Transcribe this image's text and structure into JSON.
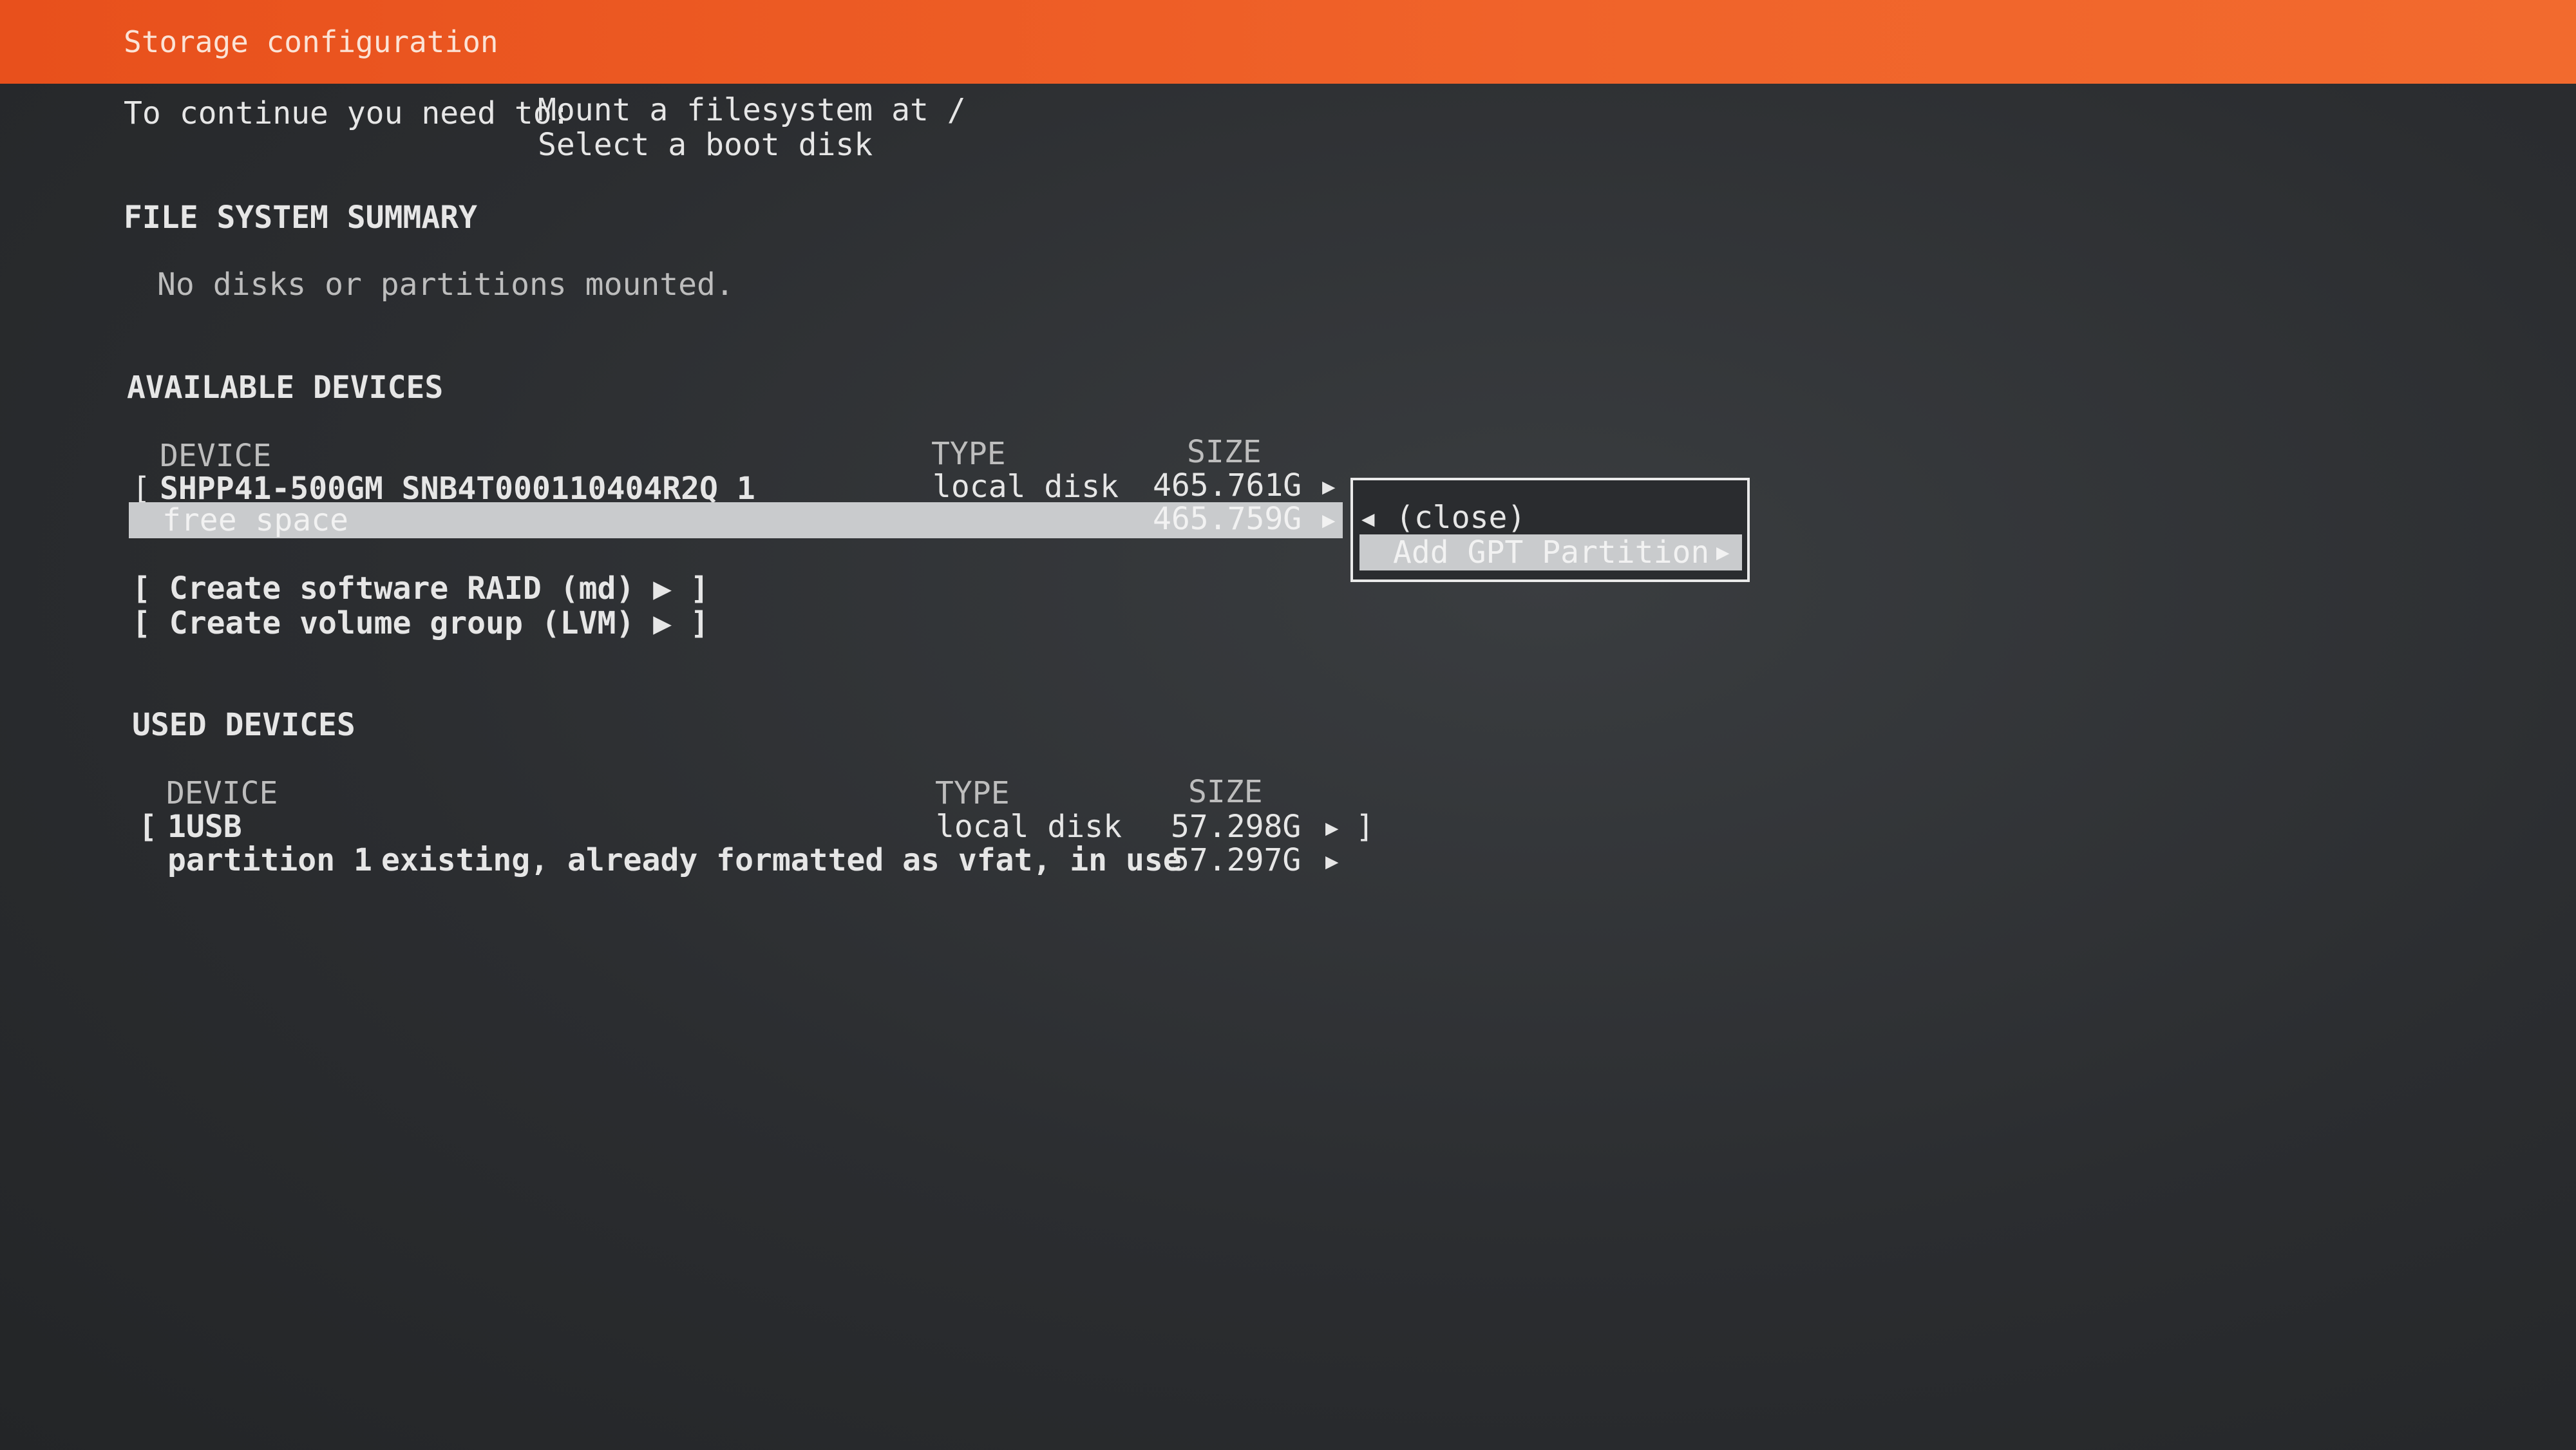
{
  "header": {
    "title": "Storage configuration",
    "color": "#e8501c"
  },
  "requirements": {
    "prefix": "To continue you need to:",
    "items": [
      "Mount a filesystem at /",
      "Select a boot disk"
    ]
  },
  "fs_summary": {
    "heading": "FILE SYSTEM SUMMARY",
    "empty_text": "No disks or partitions mounted."
  },
  "available": {
    "heading": "AVAILABLE DEVICES",
    "columns": {
      "device": "DEVICE",
      "type": "TYPE",
      "size": "SIZE"
    },
    "disk": {
      "open": "[",
      "name": "SHPP41-500GM_SNB4T000110404R2Q_1",
      "type": "local disk",
      "size": "465.761G",
      "arrow": "▶"
    },
    "free": {
      "name": "free space",
      "size": "465.759G",
      "arrow": "▶"
    },
    "actions": [
      {
        "label": "[ Create software RAID (md) ▶ ]"
      },
      {
        "label": "[ Create volume group (LVM) ▶ ]"
      }
    ]
  },
  "popup": {
    "close": {
      "arrow": "◀",
      "label": "(close)"
    },
    "add": {
      "label": "Add GPT Partition",
      "arrow": "▶"
    }
  },
  "used": {
    "heading": "USED DEVICES",
    "columns": {
      "device": "DEVICE",
      "type": "TYPE",
      "size": "SIZE"
    },
    "disk": {
      "open": "[",
      "name": "1USB",
      "type": "local disk",
      "size": "57.298G",
      "arrow": "▶",
      "close": "]"
    },
    "partition": {
      "name": "partition 1",
      "desc": "existing, already formatted as vfat, in use",
      "size": "57.297G",
      "arrow": "▶"
    }
  }
}
